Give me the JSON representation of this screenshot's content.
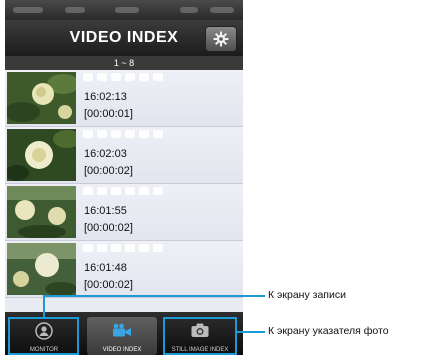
{
  "header": {
    "title": "VIDEO INDEX",
    "settings_icon": "gear-icon"
  },
  "range_label": "1 ~ 8",
  "videos": [
    {
      "time": "16:02:13",
      "duration": "[00:00:01]"
    },
    {
      "time": "16:02:03",
      "duration": "[00:00:02]"
    },
    {
      "time": "16:01:55",
      "duration": "[00:00:02]"
    },
    {
      "time": "16:01:48",
      "duration": "[00:00:02]"
    }
  ],
  "tabs": {
    "monitor": "MONITOR",
    "video_index": "VIDEO INDEX",
    "still_image_index": "STILL IMAGE INDEX"
  },
  "callouts": {
    "monitor": "К экрану записи",
    "still_image_index": "К экрану указателя фото"
  },
  "colors": {
    "callout": "#1b9ad6",
    "titlebar": "#2a2a2a"
  }
}
